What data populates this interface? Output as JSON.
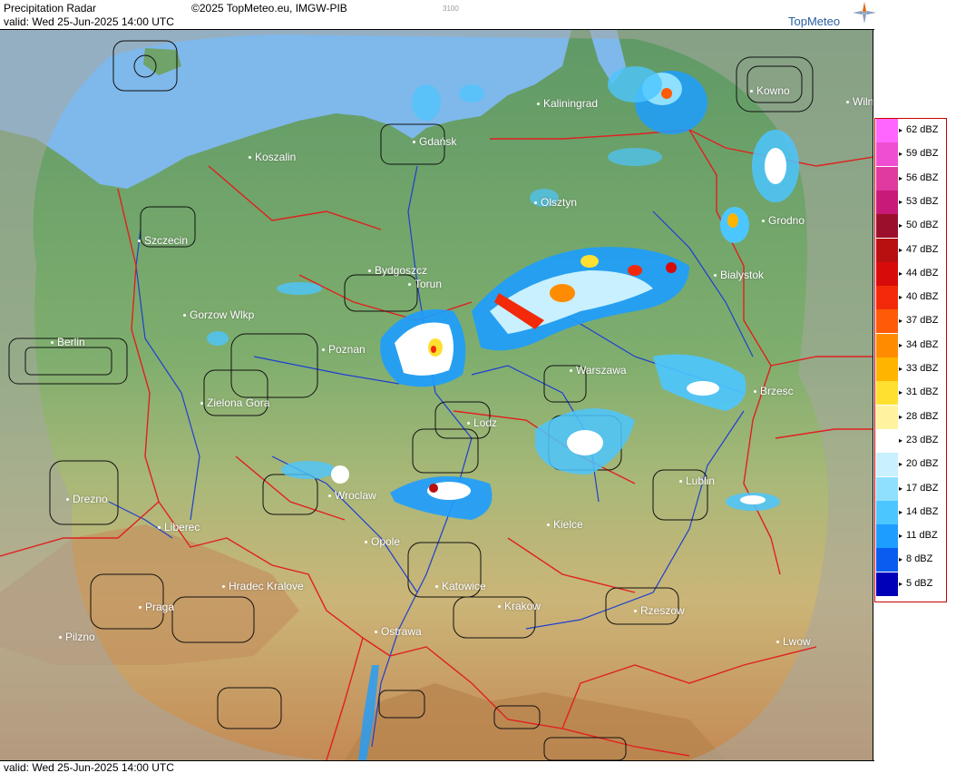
{
  "header": {
    "title": "Precipitation Radar",
    "copyright": "©2025 TopMeteo.eu, IMGW-PIB",
    "valid": "valid:  Wed  25-Jun-2025 14:00 UTC",
    "code": "3100",
    "brand": "TopMeteo"
  },
  "footer": {
    "valid": "valid:  Wed  25-Jun-2025 14:00 UTC"
  },
  "colors": {
    "sea": "#7fb8ea",
    "lowland": "#6fa36a",
    "upland": "#c9c07a",
    "mountain": "#c98f5a",
    "border": "#e02020",
    "river": "#1f3fd0",
    "airspace": "#111111",
    "outside_radar": "#a8a8a0"
  },
  "cities": [
    {
      "id": "gdansk",
      "name": "Gdańsk"
    },
    {
      "id": "kaliningrad",
      "name": "Kaliningrad"
    },
    {
      "id": "kowno",
      "name": "Kowno"
    },
    {
      "id": "wilno",
      "name": "Wilno"
    },
    {
      "id": "koszalin",
      "name": "Koszalin"
    },
    {
      "id": "olsztyn",
      "name": "Olsztyn"
    },
    {
      "id": "grodno",
      "name": "Grodno"
    },
    {
      "id": "szczecin",
      "name": "Szczecin"
    },
    {
      "id": "bydgoszcz",
      "name": "Bydgoszcz"
    },
    {
      "id": "torun",
      "name": "Torun"
    },
    {
      "id": "bialystok",
      "name": "Bialystok"
    },
    {
      "id": "gorzow",
      "name": "Gorzow Wlkp"
    },
    {
      "id": "berlin",
      "name": "Berlin"
    },
    {
      "id": "poznan",
      "name": "Poznan"
    },
    {
      "id": "warszawa",
      "name": "Warszawa"
    },
    {
      "id": "brzesc",
      "name": "Brzesc"
    },
    {
      "id": "zielona",
      "name": "Zielona Gora"
    },
    {
      "id": "lodz",
      "name": "Lodz"
    },
    {
      "id": "wroclaw",
      "name": "Wroclaw"
    },
    {
      "id": "lublin",
      "name": "Lublin"
    },
    {
      "id": "liberec",
      "name": "Liberec"
    },
    {
      "id": "kielce",
      "name": "Kielce"
    },
    {
      "id": "opole",
      "name": "Opole"
    },
    {
      "id": "hradec",
      "name": "Hradec Kralove"
    },
    {
      "id": "katowice",
      "name": "Katowice"
    },
    {
      "id": "praga",
      "name": "Praga"
    },
    {
      "id": "krakow",
      "name": "Krakow"
    },
    {
      "id": "rzeszow",
      "name": "Rzeszow"
    },
    {
      "id": "pilzno",
      "name": "Pilzno"
    },
    {
      "id": "ostrawa",
      "name": "Ostrawa"
    },
    {
      "id": "lwow",
      "name": "Lwow"
    },
    {
      "id": "drezno",
      "name": "Drezno"
    }
  ],
  "legend": [
    {
      "label": "62 dBZ",
      "color": "#ff66ff"
    },
    {
      "label": "59 dBZ",
      "color": "#f04ed2"
    },
    {
      "label": "56 dBZ",
      "color": "#e0399f"
    },
    {
      "label": "53 dBZ",
      "color": "#c81a78"
    },
    {
      "label": "50 dBZ",
      "color": "#9c0f2c"
    },
    {
      "label": "47 dBZ",
      "color": "#b80f10"
    },
    {
      "label": "44 dBZ",
      "color": "#d80b0b"
    },
    {
      "label": "40 dBZ",
      "color": "#f22a0a"
    },
    {
      "label": "37 dBZ",
      "color": "#ff5a08"
    },
    {
      "label": "34 dBZ",
      "color": "#ff8c00"
    },
    {
      "label": "33 dBZ",
      "color": "#ffb400"
    },
    {
      "label": "31 dBZ",
      "color": "#ffe030"
    },
    {
      "label": "28 dBZ",
      "color": "#fff3a0"
    },
    {
      "label": "23 dBZ",
      "color": "#ffffff"
    },
    {
      "label": "20 dBZ",
      "color": "#c8f0ff"
    },
    {
      "label": "17 dBZ",
      "color": "#8fe0ff"
    },
    {
      "label": "14 dBZ",
      "color": "#4cc6ff"
    },
    {
      "label": "11 dBZ",
      "color": "#1d9dff"
    },
    {
      "label": "8 dBZ",
      "color": "#0a5cf0"
    },
    {
      "label": "5 dBZ",
      "color": "#0000b8"
    }
  ]
}
